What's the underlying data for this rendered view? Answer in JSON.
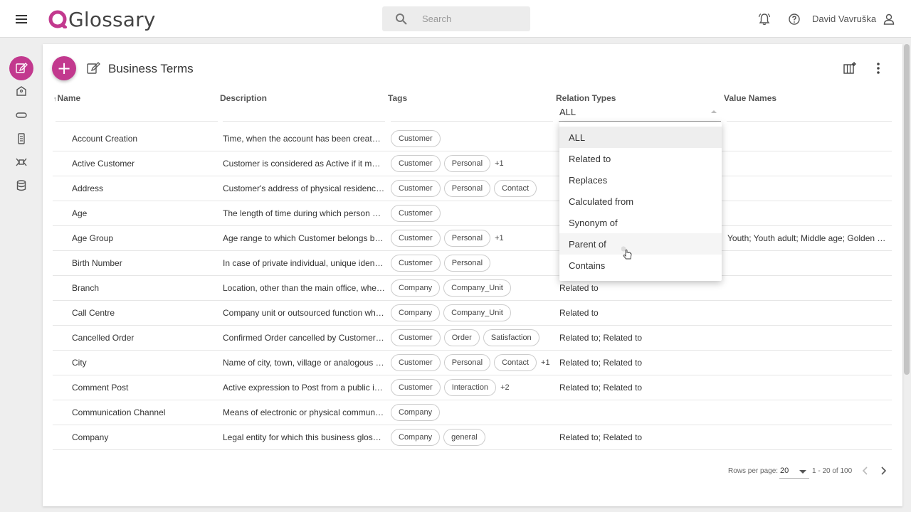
{
  "app": {
    "name": "Glossary",
    "search_placeholder": "Search",
    "user_name": "David Vavruška",
    "brand_color": "#c2398e"
  },
  "icons": {
    "menu": "menu-icon",
    "search": "search-icon",
    "notifications": "bell-icon",
    "help": "help-icon",
    "user": "user-icon",
    "rail": [
      "business-terms-icon",
      "tag-icon",
      "relation-icon",
      "value-names-icon",
      "links-icon",
      "database-icon"
    ],
    "title": "edit-icon",
    "columns": "columns-icon",
    "more": "more-vertical-icon",
    "prev": "chevron-left-icon",
    "next": "chevron-right-icon"
  },
  "page": {
    "title": "Business Terms",
    "add_label": "+"
  },
  "columns": {
    "name": "Name",
    "description": "Description",
    "tags": "Tags",
    "relation_types": "Relation Types",
    "value_names": "Value Names",
    "sort_indicator": "↑"
  },
  "filter": {
    "relation_types_value": "ALL"
  },
  "dropdown": {
    "options": [
      "ALL",
      "Related to",
      "Replaces",
      "Calculated from",
      "Synonym of",
      "Parent of",
      "Contains"
    ],
    "selected_index": 0,
    "hover_index": 5
  },
  "rows": [
    {
      "name": "Account Creation",
      "description": "Time, when the account has been created ...",
      "tags": [
        "Customer"
      ],
      "more": "",
      "relations": "",
      "values": ""
    },
    {
      "name": "Active Customer",
      "description": "Customer is considered as Active if it meets...",
      "tags": [
        "Customer",
        "Personal"
      ],
      "more": "+1",
      "relations": "",
      "values": ""
    },
    {
      "name": "Address",
      "description": "Customer's address of physical residence ...",
      "tags": [
        "Customer",
        "Personal",
        "Contact"
      ],
      "more": "",
      "relations": "",
      "values": ""
    },
    {
      "name": "Age",
      "description": "The length of time during which person has...",
      "tags": [
        "Customer"
      ],
      "more": "",
      "relations": "",
      "values": ""
    },
    {
      "name": "Age Group",
      "description": "Age range to which Customer belongs based...",
      "tags": [
        "Customer",
        "Personal"
      ],
      "more": "+1",
      "relations": "",
      "values": "Youth; Youth adult; Middle age; Golden age..."
    },
    {
      "name": "Birth Number",
      "description": "In case of private individual, unique identifier...",
      "tags": [
        "Customer",
        "Personal"
      ],
      "more": "",
      "relations": "",
      "values": ""
    },
    {
      "name": "Branch",
      "description": "Location, other than the main office, where...",
      "tags": [
        "Company",
        "Company_Unit"
      ],
      "more": "",
      "relations": "Related to",
      "values": ""
    },
    {
      "name": "Call Centre",
      "description": "Company unit or outsourced function which...",
      "tags": [
        "Company",
        "Company_Unit"
      ],
      "more": "",
      "relations": "Related to",
      "values": ""
    },
    {
      "name": "Cancelled Order",
      "description": "Confirmed Order cancelled by Customer before...",
      "tags": [
        "Customer",
        "Order",
        "Satisfaction"
      ],
      "more": "",
      "relations": "Related to; Related to",
      "values": ""
    },
    {
      "name": "City",
      "description": "Name of city, town, village or analogous area...",
      "tags": [
        "Customer",
        "Personal",
        "Contact"
      ],
      "more": "+1",
      "relations": "Related to; Related to",
      "values": ""
    },
    {
      "name": "Comment Post",
      "description": "Active expression to Post from a public in ...",
      "tags": [
        "Customer",
        "Interaction"
      ],
      "more": "+2",
      "relations": "Related to; Related to",
      "values": ""
    },
    {
      "name": "Communication Channel",
      "description": "Means of electronic or physical communication...",
      "tags": [
        "Company"
      ],
      "more": "",
      "relations": "",
      "values": ""
    },
    {
      "name": "Company",
      "description": "Legal entity for which this business glossary...",
      "tags": [
        "Company",
        "general"
      ],
      "more": "",
      "relations": "Related to; Related to",
      "values": ""
    }
  ],
  "pagination": {
    "rows_per_page_label": "Rows per page:",
    "rows_per_page": "20",
    "range": "1 - 20 of 100"
  }
}
